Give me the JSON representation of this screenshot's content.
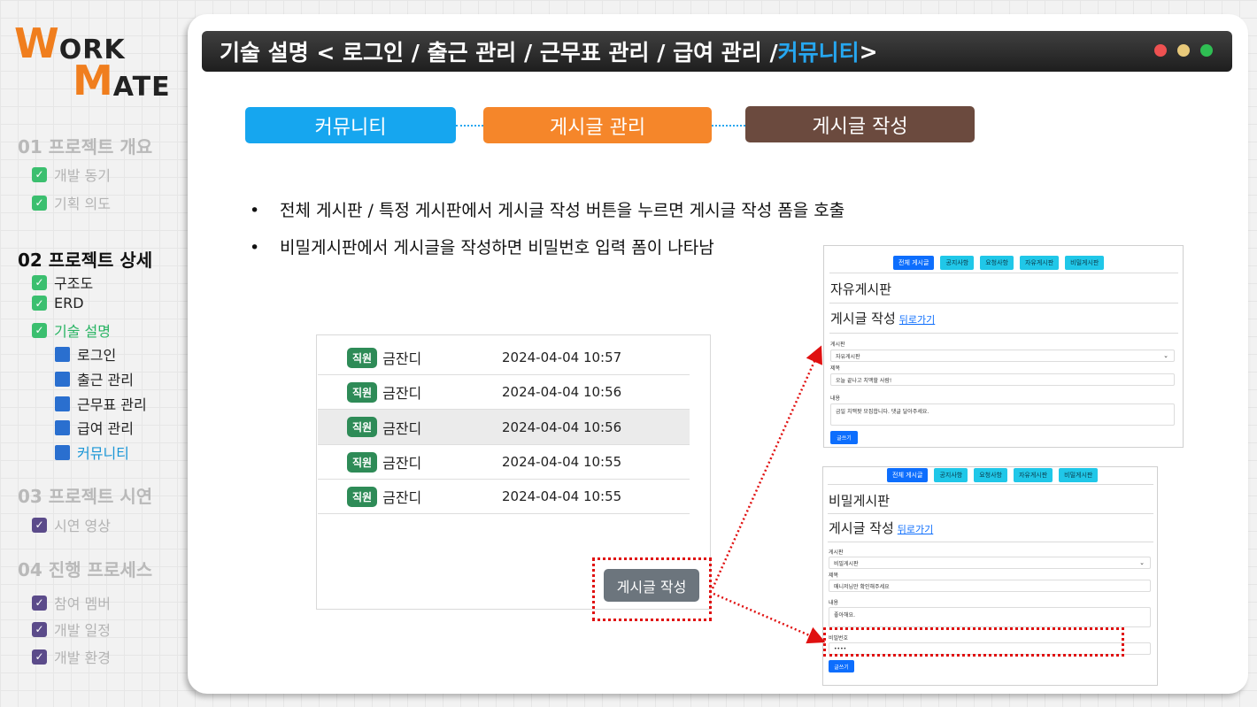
{
  "logo": {
    "w": "W",
    "ork": "ORK",
    "m": "M",
    "ate": "ATE"
  },
  "sidebar": {
    "sec1": "01 프로젝트 개요",
    "sec1_items": [
      "개발 동기",
      "기획 의도"
    ],
    "sec2": "02 프로젝트 상세",
    "sec2_items": [
      "구조도",
      "ERD",
      "기술 설명"
    ],
    "sec2_sub": [
      "로그인",
      "출근 관리",
      "근무표 관리",
      "급여 관리",
      "커뮤니티"
    ],
    "sec3": "03 프로젝트 시연",
    "sec3_items": [
      "시연 영상"
    ],
    "sec4": "04 진행 프로세스",
    "sec4_items": [
      "참여 멤버",
      "개발 일정",
      "개발 환경"
    ]
  },
  "title": {
    "prefix": "기술 설명 < 로그인 / 출근 관리 / 근무표 관리 / 급여 관리 / ",
    "highlight": "커뮤니티",
    "suffix": " >"
  },
  "window_dots": {
    "red": "#ee5151",
    "yellow": "#e8c97a",
    "green": "#2fbe53"
  },
  "flow": [
    {
      "label": "커뮤니티",
      "color": "#16a6ef"
    },
    {
      "label": "게시글 관리",
      "color": "#f5862a"
    },
    {
      "label": "게시글 작성",
      "color": "#6b4a3e"
    }
  ],
  "bullets": [
    "전체 게시판 / 특정 게시판에서 게시글 작성 버튼을 누르면 게시글 작성 폼을 호출",
    "비밀게시판에서 게시글을 작성하면 비밀번호 입력 폼이 나타남"
  ],
  "bullet_mark": "•",
  "list": {
    "rows": [
      {
        "tag": "직원",
        "name": "금잔디",
        "date": "2024-04-04 10:57"
      },
      {
        "tag": "직원",
        "name": "금잔디",
        "date": "2024-04-04 10:56"
      },
      {
        "tag": "직원",
        "name": "금잔디",
        "date": "2024-04-04 10:56"
      },
      {
        "tag": "직원",
        "name": "금잔디",
        "date": "2024-04-04 10:55"
      },
      {
        "tag": "직원",
        "name": "금잔디",
        "date": "2024-04-04 10:55"
      }
    ],
    "write_button": "게시글 작성"
  },
  "form_free": {
    "tabs": [
      "전체 게시글",
      "공지사항",
      "요청사항",
      "자유게시판",
      "비밀게시판"
    ],
    "board_title": "자유게시판",
    "heading": "게시글 작성",
    "back_link": "뒤로가기",
    "label_board": "게시판",
    "board_value": "자유게시판",
    "label_title": "제목",
    "title_value": "오늘 끝나고 치맥할 사람!",
    "label_content": "내용",
    "content_value": "금일 치맥팟 모집합니다. 댓글 달아주세요.",
    "submit": "글쓰기"
  },
  "form_secret": {
    "tabs": [
      "전체 게시글",
      "공지사항",
      "요청사항",
      "자유게시판",
      "비밀게시판"
    ],
    "board_title": "비밀게시판",
    "heading": "게시글 작성",
    "back_link": "뒤로가기",
    "label_board": "게시판",
    "board_value": "비밀게시판",
    "label_title": "제목",
    "title_value": "매니저님만 확인해주세요",
    "label_content": "내용",
    "content_value": "좋아해요.",
    "label_password": "비밀번호",
    "password_value": "••••",
    "submit": "글쓰기"
  },
  "icons": {
    "check": "check-icon",
    "chevron": "chevron-down-icon"
  }
}
